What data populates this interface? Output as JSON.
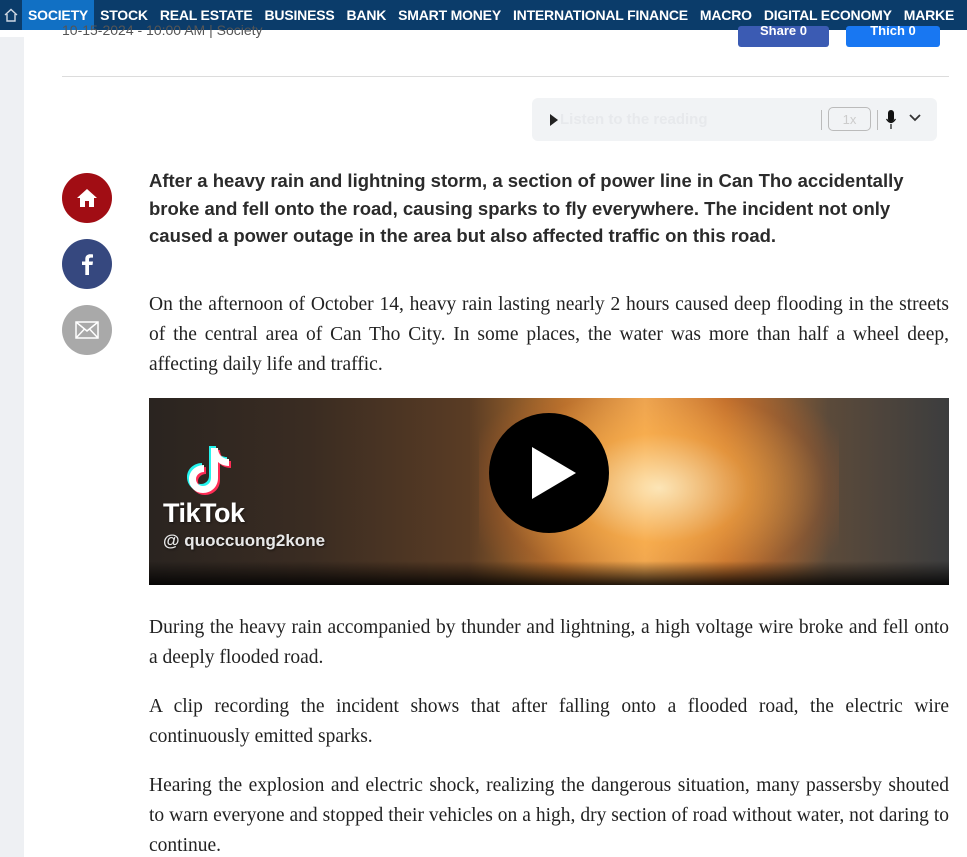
{
  "nav": {
    "items": [
      {
        "label": "SOCIETY",
        "active": true
      },
      {
        "label": "STOCK"
      },
      {
        "label": "REAL ESTATE"
      },
      {
        "label": "BUSINESS"
      },
      {
        "label": "BANK"
      },
      {
        "label": "SMART MONEY"
      },
      {
        "label": "INTERNATIONAL FINANCE"
      },
      {
        "label": "MACRO"
      },
      {
        "label": "DIGITAL ECONOMY"
      },
      {
        "label": "MARKE"
      }
    ],
    "colors": {
      "background": "#0b3c6a",
      "active": "#1170c4"
    }
  },
  "meta": {
    "datetime": "10-15-2024 - 10:00 AM",
    "category": "Society",
    "share_label": "Share 0",
    "like_label": "Thích 0"
  },
  "listen": {
    "label": "Listen to the reading",
    "speed": "1x"
  },
  "social": {
    "icons": [
      "home-icon",
      "facebook-icon",
      "mail-icon"
    ]
  },
  "article": {
    "lead": "After a heavy rain and lightning storm, a section of power line in Can Tho accidentally broke and fell onto the road, causing sparks to fly everywhere. The incident not only caused a power outage in the area but also affected traffic on this road.",
    "p1": "On the afternoon of October 14, heavy rain lasting nearly 2 hours caused deep flooding in the streets of the central area of Can Tho City. In some places, the water was more than half a wheel deep, affecting daily life and traffic.",
    "video": {
      "brand": "TikTok",
      "handle": "@ quoccuong2kone"
    },
    "p2": "During the heavy rain accompanied by thunder and lightning, a high voltage wire broke and fell onto a deeply flooded road.",
    "p3": "A clip recording the incident shows that after falling onto a flooded road, the electric wire continuously emitted sparks.",
    "p4": "Hearing the explosion and electric shock, realizing the dangerous situation, many passersby shouted to warn everyone and stopped their vehicles on a high, dry section of road without water, not daring to continue."
  }
}
